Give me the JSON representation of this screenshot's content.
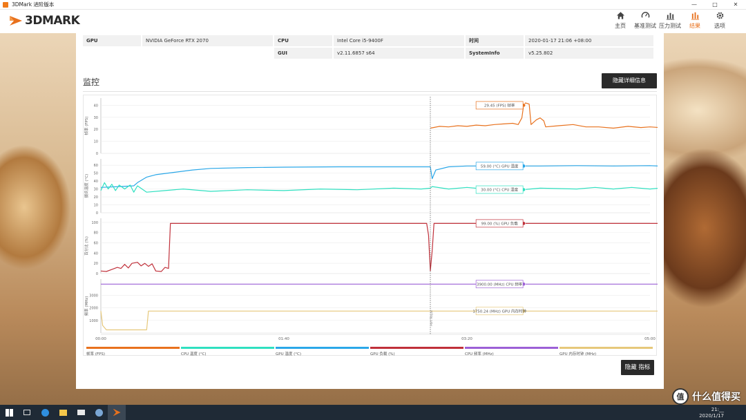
{
  "window": {
    "title": "3DMark 进阶版本",
    "controls": [
      "—",
      "□",
      "✕"
    ]
  },
  "app": {
    "logo_text": "3DMARK",
    "accent": "#e8711d"
  },
  "nav": [
    {
      "label": "主页",
      "icon": "home-icon",
      "active": false
    },
    {
      "label": "基准测试",
      "icon": "gauge-icon",
      "active": false
    },
    {
      "label": "压力测试",
      "icon": "stress-bars-icon",
      "active": false
    },
    {
      "label": "结果",
      "icon": "results-bars-icon",
      "active": true
    },
    {
      "label": "选项",
      "icon": "gear-icon",
      "active": false
    }
  ],
  "info": {
    "rows": [
      [
        {
          "key": "GPU",
          "value": "NVIDIA GeForce RTX 2070"
        },
        {
          "key": "CPU",
          "value": "Intel Core i5-9400F"
        },
        {
          "key": "时间",
          "value": "2020-01-17 21:06 +08:00"
        }
      ],
      [
        {
          "key": "",
          "value": ""
        },
        {
          "key": "GUI",
          "value": "v2.11.6857 s64"
        },
        {
          "key": "SystemInfo",
          "value": "v5.25.802"
        }
      ]
    ]
  },
  "monitor": {
    "title": "监控",
    "hide_detail_label": "隐藏详细信息",
    "hide_metrics_label": "隐藏 指标"
  },
  "chart_data": {
    "type": "line",
    "x_ticks": [
      "00:00",
      "01:40",
      "03:20",
      "05:00"
    ],
    "x_range": [
      0,
      300
    ],
    "marker": {
      "x": 180,
      "label": "Port Royal"
    },
    "cursor_x": 231,
    "panels": [
      {
        "ylabel": "帧率 (FPS)",
        "yticks": [
          0,
          10,
          20,
          30,
          40
        ],
        "ylim": [
          0,
          46
        ],
        "series": [
          {
            "name": "帧率 (FPS)",
            "color": "#e8711d",
            "points": [
              [
                180,
                21
              ],
              [
                185,
                22.5
              ],
              [
                190,
                22
              ],
              [
                195,
                23
              ],
              [
                200,
                22.5
              ],
              [
                205,
                23.5
              ],
              [
                210,
                23
              ],
              [
                215,
                24
              ],
              [
                220,
                24.5
              ],
              [
                225,
                25
              ],
              [
                228,
                24
              ],
              [
                230,
                29.5
              ],
              [
                231,
                40
              ],
              [
                232,
                42
              ],
              [
                234,
                41
              ],
              [
                235,
                24
              ],
              [
                238,
                28
              ],
              [
                240,
                29.5
              ],
              [
                242,
                27
              ],
              [
                243,
                22
              ],
              [
                250,
                23
              ],
              [
                258,
                24
              ],
              [
                265,
                22
              ],
              [
                272,
                22
              ],
              [
                280,
                21
              ],
              [
                288,
                22.5
              ],
              [
                295,
                21.5
              ],
              [
                300,
                22
              ],
              [
                305,
                21.5
              ]
            ],
            "callout": "29.45 (FPS) 帧率"
          }
        ]
      },
      {
        "ylabel": "摄氏温度 (°C)",
        "yticks": [
          0,
          10,
          20,
          30,
          40,
          50,
          60
        ],
        "ylim": [
          0,
          68
        ],
        "series": [
          {
            "name": "GPU 温度 (°C)",
            "color": "#2aa7e8",
            "points": [
              [
                0,
                32
              ],
              [
                10,
                33
              ],
              [
                18,
                34
              ],
              [
                20,
                38
              ],
              [
                25,
                45
              ],
              [
                30,
                48
              ],
              [
                40,
                51
              ],
              [
                50,
                54
              ],
              [
                60,
                56
              ],
              [
                80,
                57
              ],
              [
                100,
                57.5
              ],
              [
                130,
                58
              ],
              [
                170,
                58
              ],
              [
                180,
                58
              ],
              [
                181,
                43
              ],
              [
                183,
                54
              ],
              [
                190,
                58
              ],
              [
                200,
                59
              ],
              [
                220,
                59
              ],
              [
                240,
                59
              ],
              [
                260,
                59.5
              ],
              [
                280,
                59
              ],
              [
                300,
                59.5
              ],
              [
                305,
                59
              ]
            ],
            "callout": "59.00 (°C) GPU 温度"
          },
          {
            "name": "CPU 温度 (°C)",
            "color": "#2fe0c0",
            "points": [
              [
                0,
                28
              ],
              [
                2,
                38
              ],
              [
                4,
                30
              ],
              [
                6,
                36
              ],
              [
                8,
                28
              ],
              [
                10,
                35
              ],
              [
                13,
                30
              ],
              [
                16,
                35
              ],
              [
                18,
                26
              ],
              [
                20,
                34
              ],
              [
                25,
                26
              ],
              [
                35,
                28
              ],
              [
                45,
                30
              ],
              [
                60,
                27
              ],
              [
                80,
                29
              ],
              [
                100,
                28
              ],
              [
                120,
                30
              ],
              [
                140,
                29
              ],
              [
                160,
                31
              ],
              [
                175,
                30
              ],
              [
                180,
                31
              ],
              [
                181,
                33
              ],
              [
                190,
                30
              ],
              [
                200,
                32
              ],
              [
                210,
                30
              ],
              [
                220,
                31
              ],
              [
                230,
                29
              ],
              [
                240,
                31
              ],
              [
                260,
                30
              ],
              [
                270,
                32
              ],
              [
                280,
                30
              ],
              [
                290,
                32
              ],
              [
                300,
                30
              ],
              [
                305,
                31
              ]
            ],
            "callout": "30.00 (°C) CPU 温度"
          }
        ]
      },
      {
        "ylabel": "百分比 (%)",
        "yticks": [
          0,
          20,
          40,
          60,
          80,
          100
        ],
        "ylim": [
          0,
          108
        ],
        "series": [
          {
            "name": "GPU 负载 (%)",
            "color": "#c0303a",
            "points": [
              [
                0,
                5
              ],
              [
                3,
                4
              ],
              [
                6,
                8
              ],
              [
                9,
                12
              ],
              [
                11,
                10
              ],
              [
                13,
                18
              ],
              [
                15,
                11
              ],
              [
                17,
                20
              ],
              [
                20,
                22
              ],
              [
                22,
                15
              ],
              [
                24,
                20
              ],
              [
                26,
                14
              ],
              [
                28,
                19
              ],
              [
                30,
                5
              ],
              [
                33,
                4
              ],
              [
                35,
                12
              ],
              [
                37,
                10
              ],
              [
                38,
                98
              ],
              [
                60,
                98
              ],
              [
                100,
                98
              ],
              [
                140,
                98
              ],
              [
                170,
                98
              ],
              [
                178,
                98
              ],
              [
                179,
                75
              ],
              [
                180,
                5
              ],
              [
                181,
                45
              ],
              [
                182,
                98
              ],
              [
                200,
                98
              ],
              [
                240,
                98
              ],
              [
                280,
                98
              ],
              [
                305,
                98
              ]
            ],
            "callout": "99.00 (%) GPU 负载"
          }
        ]
      },
      {
        "ylabel": "频率 (MHz)",
        "yticks": [
          1000,
          2000,
          3000
        ],
        "ylim": [
          0,
          4300
        ],
        "series": [
          {
            "name": "CPU 频率 (MHz)",
            "color": "#9c5fd6",
            "points": [
              [
                0,
                3900
              ],
              [
                305,
                3900
              ]
            ],
            "callout": "3900.00 (MHz) CPU 频率"
          },
          {
            "name": "GPU 内存时钟 (MHz)",
            "color": "#e6c87a",
            "points": [
              [
                0,
                1750
              ],
              [
                1,
                600
              ],
              [
                3,
                250
              ],
              [
                10,
                250
              ],
              [
                20,
                250
              ],
              [
                25,
                250
              ],
              [
                26,
                1750
              ],
              [
                60,
                1750
              ],
              [
                120,
                1750
              ],
              [
                180,
                1750
              ],
              [
                240,
                1750
              ],
              [
                305,
                1750
              ]
            ],
            "callout": "1750.24 (MHz) GPU 内存时钟"
          }
        ]
      }
    ],
    "legend": [
      {
        "label": "帧率 (FPS)",
        "color": "#e8711d"
      },
      {
        "label": "CPU 温度 (°C)",
        "color": "#2fe0c0"
      },
      {
        "label": "GPU 温度 (°C)",
        "color": "#2aa7e8"
      },
      {
        "label": "GPU 负载 (%)",
        "color": "#c0303a"
      },
      {
        "label": "CPU 频率 (MHz)",
        "color": "#9c5fd6"
      },
      {
        "label": "GPU 内存时钟 (MHz)",
        "color": "#e6c87a"
      }
    ]
  },
  "taskbar": {
    "icons": [
      "windows-start-icon",
      "task-view-icon",
      "edge-icon",
      "file-explorer-icon",
      "mail-icon",
      "steam-icon",
      "3dmark-taskbar-icon"
    ],
    "clock_time": "21:__",
    "clock_date": "2020/1/17"
  },
  "watermark": {
    "seal": "值",
    "text": "什么值得买"
  }
}
